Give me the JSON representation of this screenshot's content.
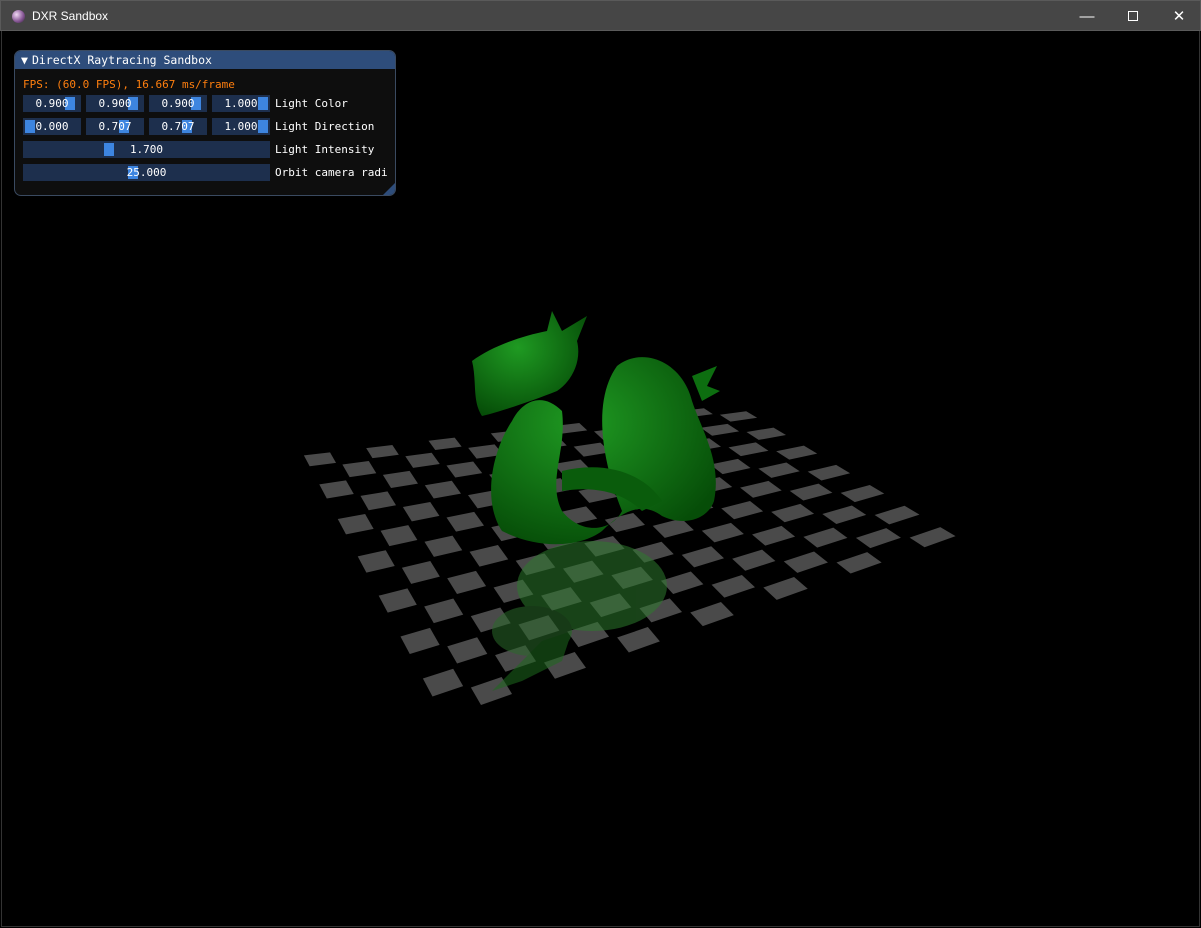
{
  "window": {
    "title": "DXR Sandbox",
    "minimize_icon": "minimize-icon",
    "maximize_icon": "maximize-icon",
    "close_icon": "close-icon"
  },
  "panel": {
    "title": "DirectX Raytracing Sandbox",
    "fps_text": "FPS: (60.0 FPS), 16.667 ms/frame",
    "rows": [
      {
        "label": "Light Color",
        "values": [
          {
            "text": "0.900",
            "grab": 0.9
          },
          {
            "text": "0.900",
            "grab": 0.9
          },
          {
            "text": "0.900",
            "grab": 0.9
          },
          {
            "text": "1.000",
            "grab": 1.0
          }
        ]
      },
      {
        "label": "Light Direction",
        "values": [
          {
            "text": "0.000",
            "grab": 0.0
          },
          {
            "text": "0.707",
            "grab": 0.707
          },
          {
            "text": "0.707",
            "grab": 0.707
          },
          {
            "text": "1.000",
            "grab": 1.0
          }
        ]
      },
      {
        "label": "Light Intensity",
        "values": [
          {
            "text": "1.700",
            "grab": 0.34
          }
        ]
      },
      {
        "label": "Orbit camera radi",
        "values": [
          {
            "text": "25.000",
            "grab": 0.444
          }
        ]
      }
    ]
  },
  "scene": {
    "dragon_color": "#0f7a12",
    "floor_tile_color": "#4a4a4a",
    "reflection_color": "#2a6a2a"
  }
}
